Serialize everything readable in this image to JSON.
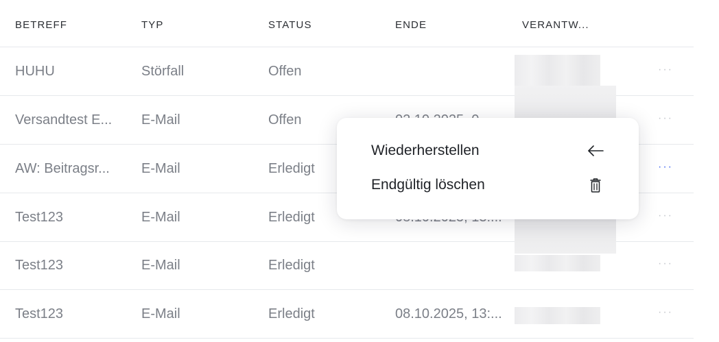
{
  "table": {
    "columns": [
      "BETREFF",
      "TYP",
      "STATUS",
      "ENDE",
      "VERANTW..."
    ],
    "rows": [
      {
        "betreff": "HUHU",
        "typ": "Störfall",
        "status": "Offen",
        "ende": "",
        "more": "···"
      },
      {
        "betreff": "Versandtest E...",
        "typ": "E-Mail",
        "status": "Offen",
        "ende": "02.10.2025, 0...",
        "more": "···"
      },
      {
        "betreff": "AW: Beitragsr...",
        "typ": "E-Mail",
        "status": "Erledigt",
        "ende": "",
        "more": "···"
      },
      {
        "betreff": "Test123",
        "typ": "E-Mail",
        "status": "Erledigt",
        "ende": "08.10.2025, 13:...",
        "more": "···"
      },
      {
        "betreff": "Test123",
        "typ": "E-Mail",
        "status": "Erledigt",
        "ende": "",
        "more": "···"
      },
      {
        "betreff": "Test123",
        "typ": "E-Mail",
        "status": "Erledigt",
        "ende": "08.10.2025, 13:...",
        "more": "···"
      }
    ]
  },
  "context_menu": {
    "items": [
      {
        "label": "Wiederherstellen",
        "icon": "arrow-left-icon"
      },
      {
        "label": "Endgültig löschen",
        "icon": "trash-icon"
      }
    ]
  },
  "colors": {
    "text_muted": "#7b7f87",
    "header_text": "#2b2e33",
    "accent": "#4a6cf0",
    "divider": "#e6e8ec"
  }
}
